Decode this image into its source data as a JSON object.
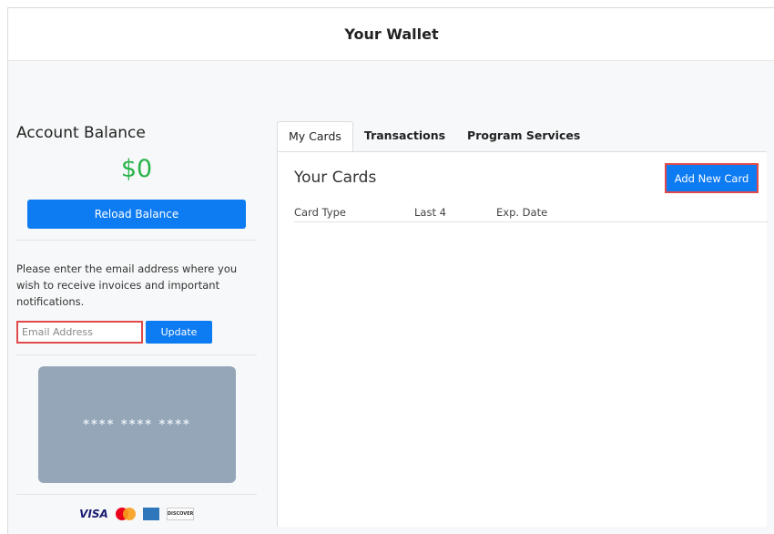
{
  "header": {
    "title": "Your Wallet"
  },
  "left": {
    "account_title": "Account Balance",
    "balance": "$0",
    "reload_label": "Reload Balance",
    "notice": "Please enter the email address where you wish to receive invoices and important notifications.",
    "email": {
      "placeholder": "Email Address",
      "value": ""
    },
    "update_label": "Update",
    "card_masked": "**** **** ****",
    "logos": [
      {
        "name": "visa-icon",
        "label": "VISA"
      },
      {
        "name": "mastercard-icon"
      },
      {
        "name": "amex-icon"
      },
      {
        "name": "discover-icon",
        "label": "DISCOVER"
      }
    ]
  },
  "tabs": [
    {
      "label": "My Cards",
      "active": true
    },
    {
      "label": "Transactions",
      "active": false
    },
    {
      "label": "Program Services",
      "active": false
    }
  ],
  "cards": {
    "title": "Your Cards",
    "add_label": "Add New Card",
    "columns": [
      "Card Type",
      "Last 4",
      "Exp. Date"
    ]
  },
  "colors": {
    "primary": "#0d7bf2",
    "balance_green": "#2bb34b",
    "highlight_red": "#e04a4a",
    "card_gray": "#95a6b8"
  }
}
